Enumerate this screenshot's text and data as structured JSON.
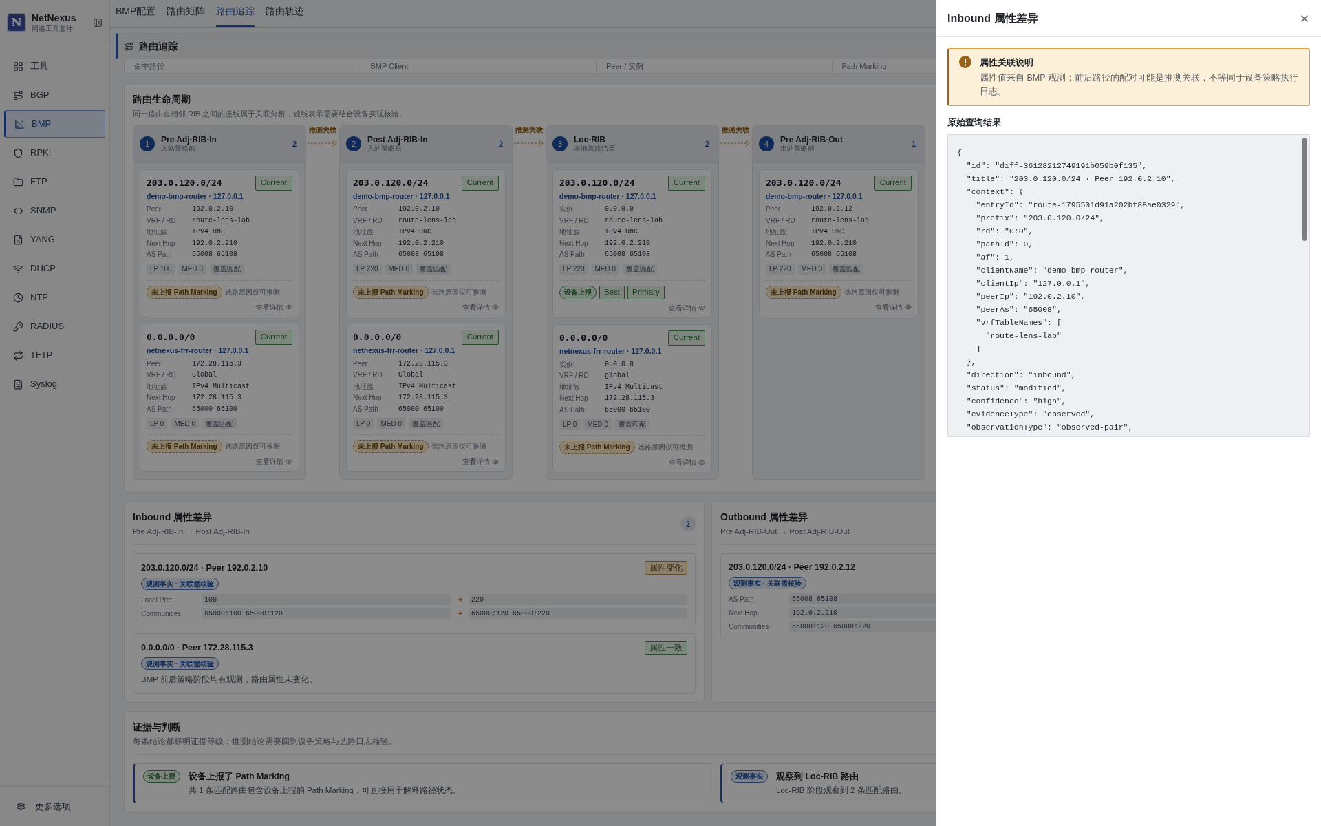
{
  "sidebar": {
    "brand": {
      "logo": "N",
      "name": "NetNexus",
      "subtitle": "网络工具套件"
    },
    "items": [
      {
        "label": "工具",
        "selected": false
      },
      {
        "label": "BGP",
        "selected": false
      },
      {
        "label": "BMP",
        "selected": true
      },
      {
        "label": "RPKI",
        "selected": false
      },
      {
        "label": "FTP",
        "selected": false
      },
      {
        "label": "SNMP",
        "selected": false
      },
      {
        "label": "YANG",
        "selected": false
      },
      {
        "label": "DHCP",
        "selected": false
      },
      {
        "label": "NTP",
        "selected": false
      },
      {
        "label": "RADIUS",
        "selected": false
      },
      {
        "label": "TFTP",
        "selected": false
      },
      {
        "label": "Syslog",
        "selected": false
      }
    ],
    "footer": "更多选项"
  },
  "tabs": [
    {
      "label": "BMP配置",
      "selected": false
    },
    {
      "label": "路由矩阵",
      "selected": false
    },
    {
      "label": "路由追踪",
      "selected": true
    },
    {
      "label": "路由轨迹",
      "selected": false
    }
  ],
  "trace": {
    "title": "路由追踪",
    "columns": [
      "命中路径",
      "BMP Client",
      "Peer / 实例",
      "Path Marking"
    ]
  },
  "lifecycle": {
    "title": "路由生命周期",
    "subtitle": "同一路由在相邻 RIB 之间的连线属于关联分析，虚线表示需要结合设备实现核验。",
    "connectors": [
      "推测关联",
      "推测关联",
      "推测关联"
    ],
    "stages": [
      {
        "number": "1",
        "name": "Pre Adj-RIB-In",
        "subtitle": "入站策略前",
        "count": "2",
        "routes": [
          {
            "prefix": "203.0.120.0/24",
            "status": "Current",
            "client": "demo-bmp-router · 127.0.0.1",
            "fields": [
              {
                "label": "Peer",
                "value": "192.0.2.10"
              },
              {
                "label": "VRF / RD",
                "value": "route-lens-lab"
              },
              {
                "label": "地址族",
                "value": "IPv4 UNC"
              },
              {
                "label": "Next Hop",
                "value": "192.0.2.210"
              },
              {
                "label": "AS Path",
                "value": "65008 65108"
              }
            ],
            "tags": [
              "LP 100",
              "MED 0",
              "覆盖匹配"
            ],
            "marking": {
              "kind": "unreported",
              "badges": [
                "未上报 Path Marking"
              ],
              "note": "选路原因仅可推测"
            },
            "detail": "查看详情"
          },
          {
            "prefix": "0.0.0.0/0",
            "status": "Current",
            "client": "netnexus-frr-router · 127.0.0.1",
            "fields": [
              {
                "label": "Peer",
                "value": "172.28.115.3"
              },
              {
                "label": "VRF / RD",
                "value": "Global"
              },
              {
                "label": "地址族",
                "value": "IPv4 Multicast"
              },
              {
                "label": "Next Hop",
                "value": "172.28.115.3"
              },
              {
                "label": "AS Path",
                "value": "65000 65100"
              }
            ],
            "tags": [
              "LP 0",
              "MED 0",
              "覆盖匹配"
            ],
            "marking": {
              "kind": "unreported",
              "badges": [
                "未上报 Path Marking"
              ],
              "note": "选路原因仅可推测"
            },
            "detail": "查看详情"
          }
        ]
      },
      {
        "number": "2",
        "name": "Post Adj-RIB-In",
        "subtitle": "入站策略后",
        "count": "2",
        "routes": [
          {
            "prefix": "203.0.120.0/24",
            "status": "Current",
            "client": "demo-bmp-router · 127.0.0.1",
            "fields": [
              {
                "label": "Peer",
                "value": "192.0.2.10"
              },
              {
                "label": "VRF / RD",
                "value": "route-lens-lab"
              },
              {
                "label": "地址族",
                "value": "IPv4 UNC"
              },
              {
                "label": "Next Hop",
                "value": "192.0.2.210"
              },
              {
                "label": "AS Path",
                "value": "65008 65108"
              }
            ],
            "tags": [
              "LP 220",
              "MED 0",
              "覆盖匹配"
            ],
            "marking": {
              "kind": "unreported",
              "badges": [
                "未上报 Path Marking"
              ],
              "note": "选路原因仅可推测"
            },
            "detail": "查看详情"
          },
          {
            "prefix": "0.0.0.0/0",
            "status": "Current",
            "client": "netnexus-frr-router · 127.0.0.1",
            "fields": [
              {
                "label": "Peer",
                "value": "172.28.115.3"
              },
              {
                "label": "VRF / RD",
                "value": "Global"
              },
              {
                "label": "地址族",
                "value": "IPv4 Multicast"
              },
              {
                "label": "Next Hop",
                "value": "172.28.115.3"
              },
              {
                "label": "AS Path",
                "value": "65000 65100"
              }
            ],
            "tags": [
              "LP 0",
              "MED 0",
              "覆盖匹配"
            ],
            "marking": {
              "kind": "unreported",
              "badges": [
                "未上报 Path Marking"
              ],
              "note": "选路原因仅可推测"
            },
            "detail": "查看详情"
          }
        ]
      },
      {
        "number": "3",
        "name": "Loc-RIB",
        "subtitle": "本地选路结果",
        "count": "2",
        "routes": [
          {
            "prefix": "203.0.120.0/24",
            "status": "Current",
            "client": "demo-bmp-router · 127.0.0.1",
            "fields": [
              {
                "label": "实例",
                "value": "0.0.0.0"
              },
              {
                "label": "VRF / RD",
                "value": "route-lens-lab"
              },
              {
                "label": "地址族",
                "value": "IPv4 UNC"
              },
              {
                "label": "Next Hop",
                "value": "192.0.2.210"
              },
              {
                "label": "AS Path",
                "value": "65008 65108"
              }
            ],
            "tags": [
              "LP 220",
              "MED 0",
              "覆盖匹配"
            ],
            "marking": {
              "kind": "reported",
              "badges": [
                "设备上报",
                "Best",
                "Primary"
              ]
            },
            "detail": "查看详情"
          },
          {
            "prefix": "0.0.0.0/0",
            "status": "Current",
            "client": "netnexus-frr-router · 127.0.0.1",
            "fields": [
              {
                "label": "实例",
                "value": "0.0.0.0"
              },
              {
                "label": "VRF / RD",
                "value": "global"
              },
              {
                "label": "地址族",
                "value": "IPv4 Multicast"
              },
              {
                "label": "Next Hop",
                "value": "172.28.115.3"
              },
              {
                "label": "AS Path",
                "value": "65000 65100"
              }
            ],
            "tags": [
              "LP 0",
              "MED 0",
              "覆盖匹配"
            ],
            "marking": {
              "kind": "unreported",
              "badges": [
                "未上报 Path Marking"
              ],
              "note": "选路原因仅可推测"
            },
            "detail": "查看详情"
          }
        ]
      },
      {
        "number": "4",
        "name": "Pre Adj-RIB-Out",
        "subtitle": "出站策略前",
        "count": "1",
        "routes": [
          {
            "prefix": "203.0.120.0/24",
            "status": "Current",
            "client": "demo-bmp-router · 127.0.0.1",
            "fields": [
              {
                "label": "Peer",
                "value": "192.0.2.12"
              },
              {
                "label": "VRF / RD",
                "value": "route-lens-lab"
              },
              {
                "label": "地址族",
                "value": "IPv4 UNC"
              },
              {
                "label": "Next Hop",
                "value": "192.0.2.210"
              },
              {
                "label": "AS Path",
                "value": "65008 65108"
              }
            ],
            "tags": [
              "LP 220",
              "MED 0",
              "覆盖匹配"
            ],
            "marking": {
              "kind": "unreported",
              "badges": [
                "未上报 Path Marking"
              ],
              "note": "选路原因仅可推测"
            },
            "detail": "查看详情"
          }
        ]
      }
    ]
  },
  "diffs": [
    {
      "title": "Inbound 属性差异",
      "subtitle": "Pre Adj-RIB-In → Post Adj-RIB-In",
      "count": "2",
      "items": [
        {
          "title": "203.0.120.0/24 · Peer 192.0.2.10",
          "status": {
            "text": "属性变化",
            "kind": "changed"
          },
          "tag": "观测事实 · 关联需核验",
          "rows": [
            {
              "label": "Local Pref",
              "before": "100",
              "after": "220"
            },
            {
              "label": "Communities",
              "before": "65000:100 65000:120",
              "after": "65000:120 65000:220"
            }
          ]
        },
        {
          "title": "0.0.0.0/0 · Peer 172.28.115.3",
          "status": {
            "text": "属性一致",
            "kind": "same"
          },
          "tag": "观测事实 · 关联需核验",
          "note": "BMP 前后策略阶段均有观测，路由属性未变化。"
        }
      ]
    },
    {
      "title": "Outbound 属性差异",
      "subtitle": "Pre Adj-RIB-Out → Post Adj-RIB-Out",
      "items": [
        {
          "title": "203.0.120.0/24 · Peer 192.0.2.12",
          "tag": "观测事实 · 关联需核验",
          "rows": [
            {
              "label": "AS Path",
              "before": "65008 65108"
            },
            {
              "label": "Next Hop",
              "before": "192.0.2.210"
            },
            {
              "label": "Communities",
              "before": "65000:120 65000:220"
            }
          ]
        }
      ]
    }
  ],
  "evidence": {
    "title": "证据与判断",
    "subtitle": "每条结论都标明证据等级；推测结论需要回到设备策略与选路日志核验。",
    "items": [
      {
        "badge": "设备上报",
        "kind": "reported",
        "title": "设备上报了 Path Marking",
        "text": "共 1 条匹配路由包含设备上报的 Path Marking，可直接用于解释路径状态。"
      },
      {
        "badge": "观测事实",
        "kind": "observed",
        "title": "观察到 Loc-RIB 路由",
        "text": "Loc-RIB 阶段观察到 2 条匹配路由。"
      }
    ]
  },
  "drawer": {
    "title": "Inbound 属性差异",
    "alert": {
      "title": "属性关联说明",
      "text": "属性值来自 BMP 观测；前后路径的配对可能是推测关联，不等同于设备策略执行日志。"
    },
    "raw_title": "原始查询结果",
    "raw": "{\n  \"id\": \"diff-36128212749191b059b0f135\",\n  \"title\": \"203.0.120.0/24 · Peer 192.0.2.10\",\n  \"context\": {\n    \"entryId\": \"route-1795501d91a202bf88ae0329\",\n    \"prefix\": \"203.0.120.0/24\",\n    \"rd\": \"0:0\",\n    \"pathId\": 0,\n    \"af\": 1,\n    \"clientName\": \"demo-bmp-router\",\n    \"clientIp\": \"127.0.0.1\",\n    \"peerIp\": \"192.0.2.10\",\n    \"peerAs\": \"65008\",\n    \"vrfTableNames\": [\n      \"route-lens-lab\"\n    ]\n  },\n  \"direction\": \"inbound\",\n  \"status\": \"modified\",\n  \"confidence\": \"high\",\n  \"evidenceType\": \"observed\",\n  \"observationType\": \"observed-pair\","
  }
}
